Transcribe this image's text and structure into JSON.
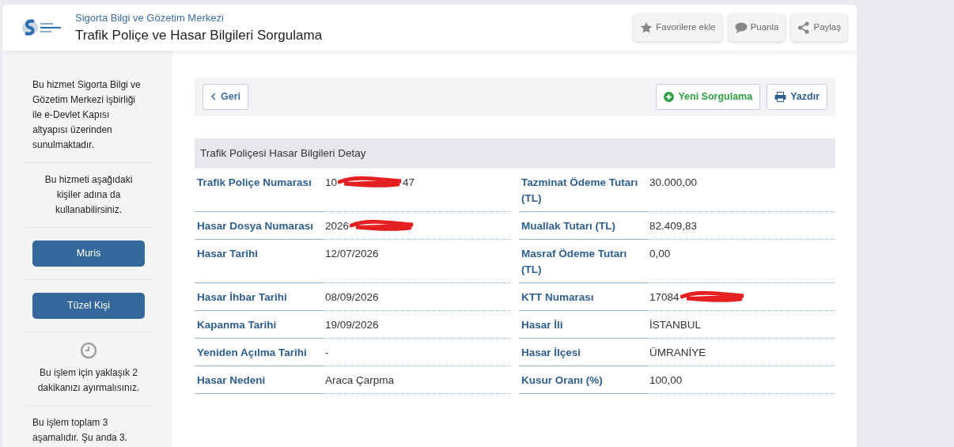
{
  "header": {
    "subtitle": "Sigorta Bilgi ve Gözetim Merkezi",
    "title": "Trafik Poliçe ve Hasar Bilgileri Sorgulama",
    "actions": [
      {
        "kind": "star",
        "label": "Favorilere ekle"
      },
      {
        "kind": "comment",
        "label": "Puanla"
      },
      {
        "kind": "share",
        "label": "Paylaş"
      }
    ]
  },
  "sidebar": [
    {
      "kind": "text",
      "text": "Bu hizmet Sigorta Bilgi ve Gözetim Merkezi işbirliği ile e-Devlet Kapısı altyapısı üzerinden sunulmaktadır."
    },
    {
      "kind": "centered",
      "text": "Bu hizmeti aşağıdaki kişiler adına da kullanabilirsiniz."
    },
    {
      "kind": "button",
      "text": "Muris"
    },
    {
      "kind": "button",
      "text": "Tüzel Kişi"
    },
    {
      "kind": "clock",
      "text": "Bu işlem için yaklaşık 2 dakikanızı ayırmalısınız."
    },
    {
      "kind": "text",
      "text": "Bu işlem toplam 3 aşamalıdır. Şu anda 3."
    }
  ],
  "toolbar": {
    "back": "Geri",
    "new_query": "Yeni Sorgulama",
    "print": "Yazdır"
  },
  "section_title": "Trafik Poliçesi Hasar Bilgileri Detay",
  "rows": [
    [
      {
        "label": "Trafik Poliçe Numarası",
        "value": "10",
        "redacted": true,
        "value_end": "47"
      },
      {
        "label": "Tazminat Ödeme Tutarı (TL)",
        "value": "30.000,00"
      }
    ],
    [
      {
        "label": "Hasar Dosya Numarası",
        "value": "2026",
        "redacted": true
      },
      {
        "label": "Muallak Tutarı (TL)",
        "value": "82.409,83"
      }
    ],
    [
      {
        "label": "Hasar Tarihi",
        "value": "12/07/2026"
      },
      {
        "label": "Masraf Ödeme Tutarı (TL)",
        "value": "0,00"
      }
    ],
    [
      {
        "label": "Hasar İhbar Tarihi",
        "value": "08/09/2026"
      },
      {
        "label": "KTT Numarası",
        "value": "17084",
        "redacted": true
      }
    ],
    [
      {
        "label": "Kapanma Tarihi",
        "value": "19/09/2026"
      },
      {
        "label": "Hasar İli",
        "value": "İSTANBUL"
      }
    ],
    [
      {
        "label": "Yeniden Açılma Tarihi",
        "value": "-"
      },
      {
        "label": "Hasar İlçesi",
        "value": "ÜMRANİYE"
      }
    ],
    [
      {
        "label": "Hasar Nedeni",
        "value": "Araca Çarpma"
      },
      {
        "label": "Kusur Oranı (%)",
        "value": "100,00"
      }
    ]
  ]
}
